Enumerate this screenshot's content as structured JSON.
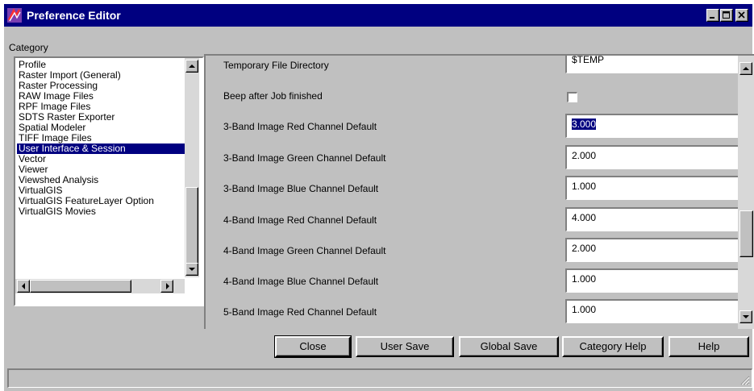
{
  "window": {
    "title": "Preference Editor",
    "icon": "erdas-imagine-app-icon"
  },
  "category": {
    "label": "Category",
    "items": [
      "Profile",
      "Raster Import (General)",
      "Raster Processing",
      "RAW Image Files",
      "RPF Image Files",
      "SDTS Raster Exporter",
      "Spatial Modeler",
      "TIFF Image Files",
      "User Interface & Session",
      "Vector",
      "Viewer",
      "Viewshed Analysis",
      "VirtualGIS",
      "VirtualGIS FeatureLayer Option",
      "VirtualGIS Movies"
    ],
    "selected": "User Interface & Session"
  },
  "preferences": [
    {
      "label": "Temporary File Directory",
      "type": "text",
      "value": "$TEMP"
    },
    {
      "label": "Beep after Job finished",
      "type": "checkbox",
      "checked": false
    },
    {
      "label": "3-Band Image Red Channel Default",
      "type": "text",
      "value": "3.000",
      "selected": true
    },
    {
      "label": "3-Band Image Green Channel Default",
      "type": "text",
      "value": "2.000"
    },
    {
      "label": "3-Band Image Blue Channel Default",
      "type": "text",
      "value": "1.000"
    },
    {
      "label": "4-Band Image Red Channel Default",
      "type": "text",
      "value": "4.000"
    },
    {
      "label": "4-Band Image Green Channel Default",
      "type": "text",
      "value": "2.000"
    },
    {
      "label": "4-Band Image Blue Channel Default",
      "type": "text",
      "value": "1.000"
    },
    {
      "label": "5-Band Image Red Channel Default",
      "type": "text",
      "value": "1.000"
    }
  ],
  "buttons": {
    "close": "Close",
    "user_save": "User Save",
    "global_save": "Global Save",
    "category_help": "Category Help",
    "help": "Help"
  },
  "colors": {
    "titlebar": "#000080",
    "selection": "#000080",
    "face": "#c0c0c0"
  }
}
